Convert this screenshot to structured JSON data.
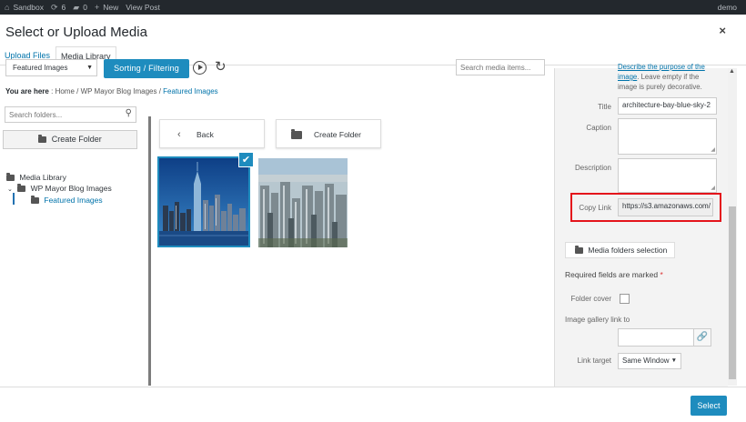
{
  "admin_bar": {
    "site_name": "Sandbox",
    "updates_count": "6",
    "comments_count": "0",
    "new_label": "New",
    "view_post_label": "View Post",
    "user_label": "demo"
  },
  "modal": {
    "title": "Select or Upload Media",
    "close_glyph": "×"
  },
  "tabs": [
    {
      "label": "Upload Files",
      "active": false
    },
    {
      "label": "Media Library",
      "active": true
    }
  ],
  "toolbar": {
    "filter_value": "Featured Images",
    "sort_button": "Sorting / Filtering",
    "search_placeholder": "Search media items..."
  },
  "breadcrumb": {
    "prefix": "You are here",
    "items": [
      "Home",
      "WP Mayor Blog Images",
      "Featured Images"
    ]
  },
  "folders": {
    "search_placeholder": "Search folders...",
    "create_label": "Create Folder",
    "tree": [
      {
        "label": "Media Library"
      },
      {
        "label": "WP Mayor Blog Images"
      },
      {
        "label": "Featured Images",
        "active": true
      }
    ]
  },
  "content": {
    "back_label": "Back",
    "create_folder_label": "Create Folder"
  },
  "details": {
    "alt_help_link": "Describe the purpose of the",
    "alt_help_word": "image",
    "alt_help_text": ". Leave empty if the image is purely decorative.",
    "title_label": "Title",
    "title_value": "architecture-bay-blue-sky-2",
    "caption_label": "Caption",
    "description_label": "Description",
    "copy_link_label": "Copy Link",
    "copy_link_value": "https://s3.amazonaws.com/",
    "media_folders_button": "Media folders selection",
    "required_text": "Required fields are marked",
    "required_star": "*",
    "folder_cover_label": "Folder cover",
    "gallery_link_label": "Image gallery link to",
    "link_target_label": "Link target",
    "link_target_value": "Same Window"
  },
  "footer": {
    "select_button": "Select"
  },
  "colors": {
    "accent": "#1e8cbe",
    "highlight": "#e4141b",
    "admin_bar": "#23282d"
  }
}
